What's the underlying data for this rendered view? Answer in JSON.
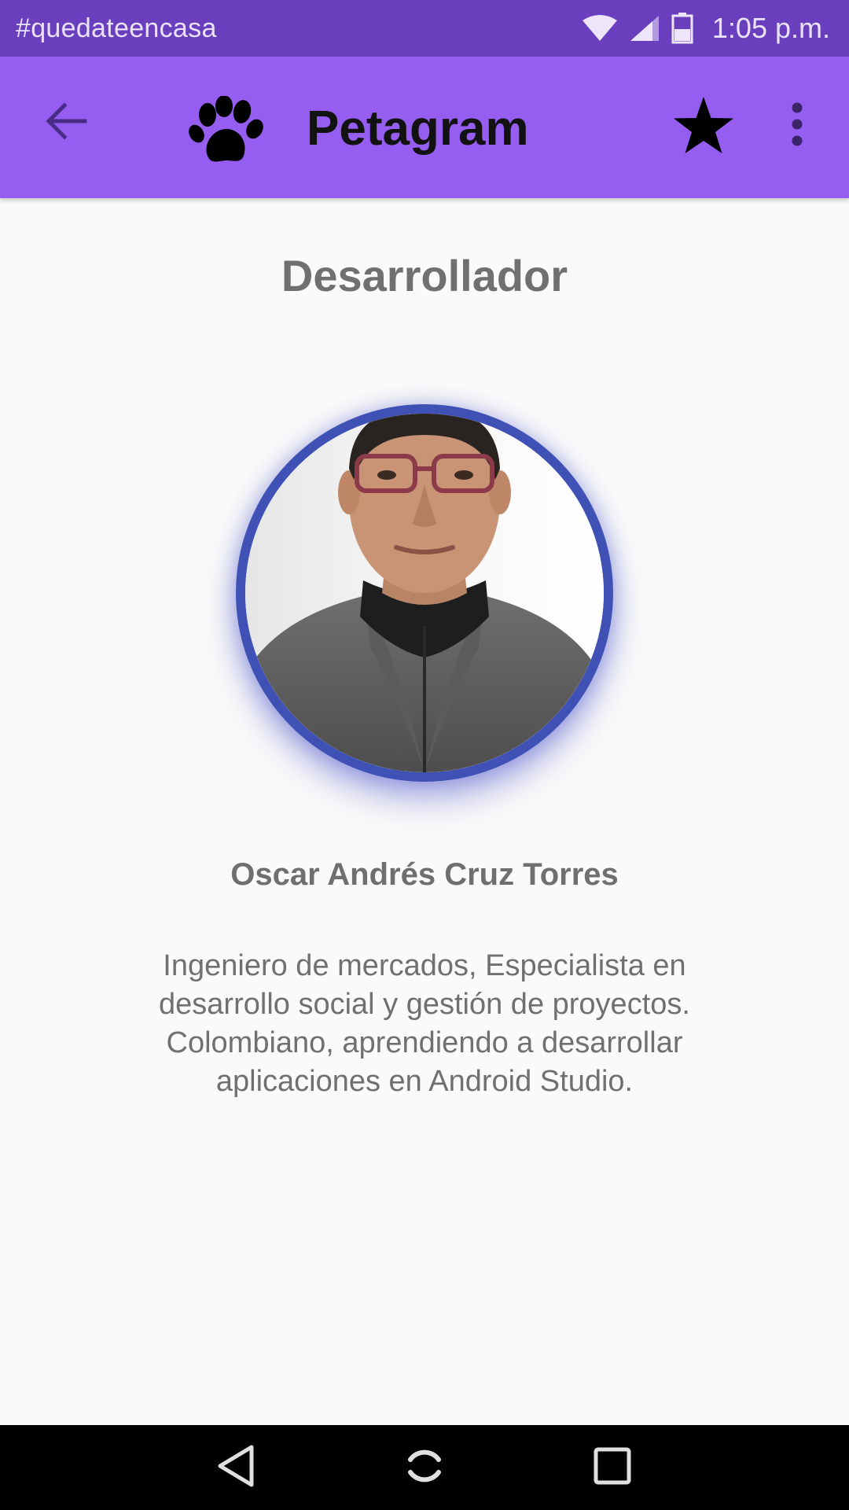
{
  "status_bar": {
    "notification_text": "#quedateencasa",
    "time": "1:05 p.m.",
    "icons": [
      "wifi-icon",
      "signal-icon",
      "battery-icon"
    ]
  },
  "app_bar": {
    "back_icon": "arrow-left-icon",
    "logo_icon": "paw-icon",
    "title": "Petagram",
    "favorites_icon": "star-icon",
    "overflow_icon": "more-vert-icon"
  },
  "content": {
    "heading": "Desarrollador",
    "developer_name": "Oscar Andrés Cruz Torres",
    "bio_lines": [
      "Ingeniero de mercados, Especialista en",
      "desarrollo social y gestión de proyectos.",
      "Colombiano, aprendiendo a desarrollar",
      "aplicaciones en Android Studio."
    ]
  },
  "nav_bar": {
    "buttons": [
      "nav-back-icon",
      "nav-home-icon",
      "nav-recents-icon"
    ]
  },
  "colors": {
    "status_bar": "#6a3fbe",
    "app_bar": "#965ef0",
    "avatar_ring": "#3f51b5",
    "text_gray": "#707070",
    "background": "#fafafa"
  }
}
